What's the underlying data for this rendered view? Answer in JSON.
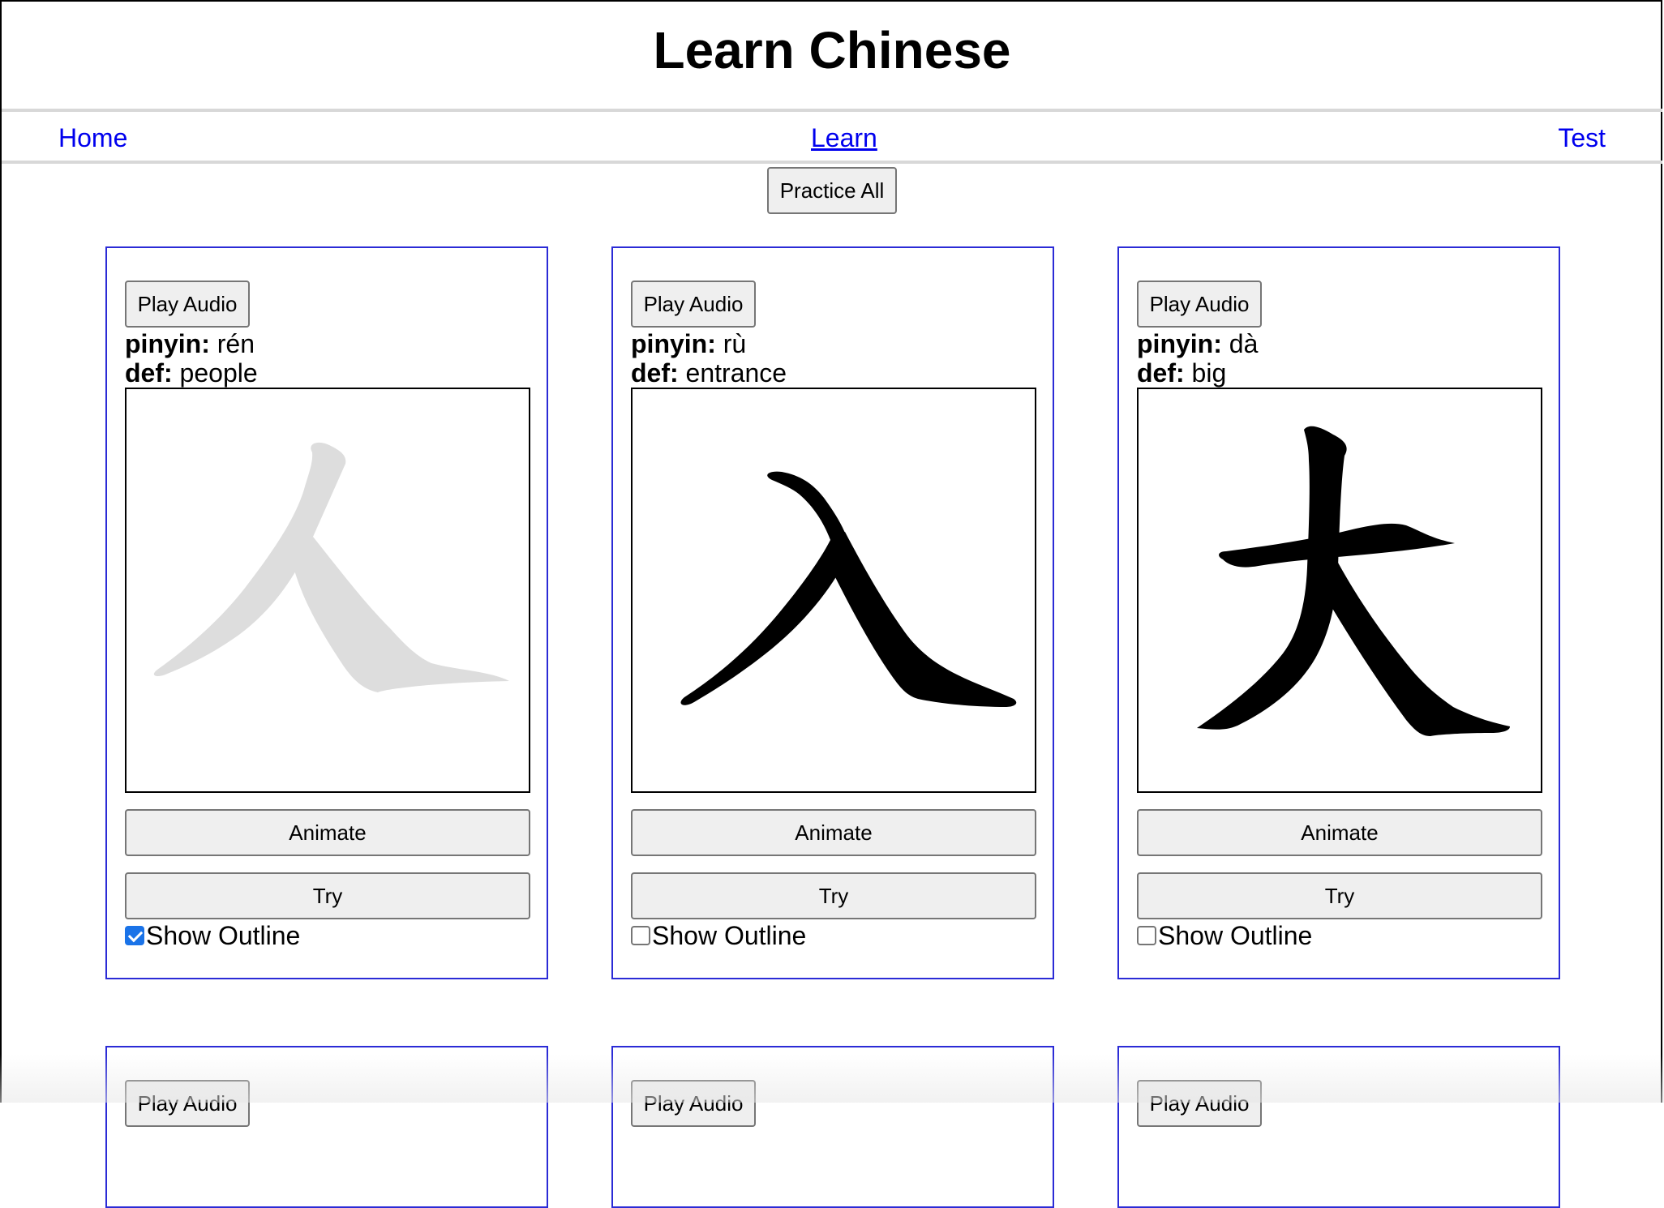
{
  "app": {
    "title": "Learn Chinese"
  },
  "nav": {
    "home": "Home",
    "learn": "Learn",
    "test": "Test"
  },
  "practice_all": "Practice All",
  "cards": [
    {
      "character": "人",
      "pinyin_label": "pinyin:",
      "pinyin": "rén",
      "def_label": "def:",
      "def": "people",
      "play_label": "Play Audio",
      "animate_label": "Animate",
      "try_label": "Try",
      "outline_label": "Show Outline",
      "outline_checked": true,
      "stroke_color": "#dddddd"
    },
    {
      "character": "入",
      "pinyin_label": "pinyin:",
      "pinyin": "rù",
      "def_label": "def:",
      "def": "entrance",
      "play_label": "Play Audio",
      "animate_label": "Animate",
      "try_label": "Try",
      "outline_label": "Show Outline",
      "outline_checked": false,
      "stroke_color": "#000000"
    },
    {
      "character": "大",
      "pinyin_label": "pinyin:",
      "pinyin": "dà",
      "def_label": "def:",
      "def": "big",
      "play_label": "Play Audio",
      "animate_label": "Animate",
      "try_label": "Try",
      "outline_label": "Show Outline",
      "outline_checked": false,
      "stroke_color": "#000000"
    }
  ],
  "next_row": {
    "play_label": "Play Audio"
  },
  "colors": {
    "link": "#0000ee",
    "card_border": "#2b2bd6",
    "checkbox": "#1a73e8"
  }
}
